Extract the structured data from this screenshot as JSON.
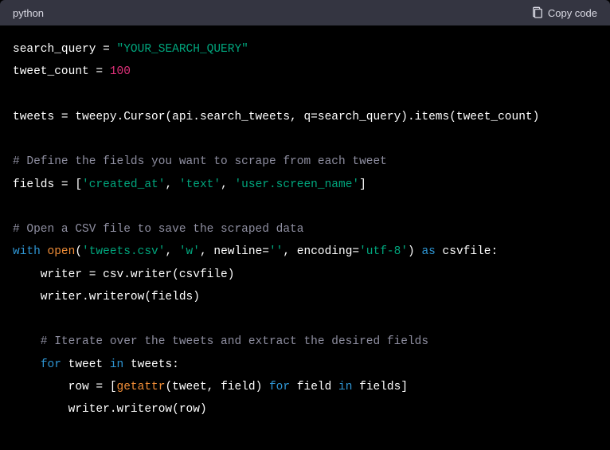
{
  "header": {
    "language": "python",
    "copy_label": "Copy code"
  },
  "code": {
    "l1_a": "search_query = ",
    "l1_b": "\"YOUR_SEARCH_QUERY\"",
    "l2_a": "tweet_count = ",
    "l2_b": "100",
    "l4": "tweets = tweepy.Cursor(api.search_tweets, q=search_query).items(tweet_count)",
    "l6": "# Define the fields you want to scrape from each tweet",
    "l7_a": "fields = [",
    "l7_b": "'created_at'",
    "l7_c": ", ",
    "l7_d": "'text'",
    "l7_e": ", ",
    "l7_f": "'user.screen_name'",
    "l7_g": "]",
    "l9": "# Open a CSV file to save the scraped data",
    "l10_a": "with",
    "l10_b": " ",
    "l10_c": "open",
    "l10_d": "(",
    "l10_e": "'tweets.csv'",
    "l10_f": ", ",
    "l10_g": "'w'",
    "l10_h": ", newline=",
    "l10_i": "''",
    "l10_j": ", encoding=",
    "l10_k": "'utf-8'",
    "l10_l": ") ",
    "l10_m": "as",
    "l10_n": " csvfile:",
    "l11": "    writer = csv.writer(csvfile)",
    "l12": "    writer.writerow(fields)",
    "l14": "    # Iterate over the tweets and extract the desired fields",
    "l15_a": "    ",
    "l15_b": "for",
    "l15_c": " tweet ",
    "l15_d": "in",
    "l15_e": " tweets:",
    "l16_a": "        row = [",
    "l16_b": "getattr",
    "l16_c": "(tweet, field) ",
    "l16_d": "for",
    "l16_e": " field ",
    "l16_f": "in",
    "l16_g": " fields]",
    "l17": "        writer.writerow(row)"
  }
}
